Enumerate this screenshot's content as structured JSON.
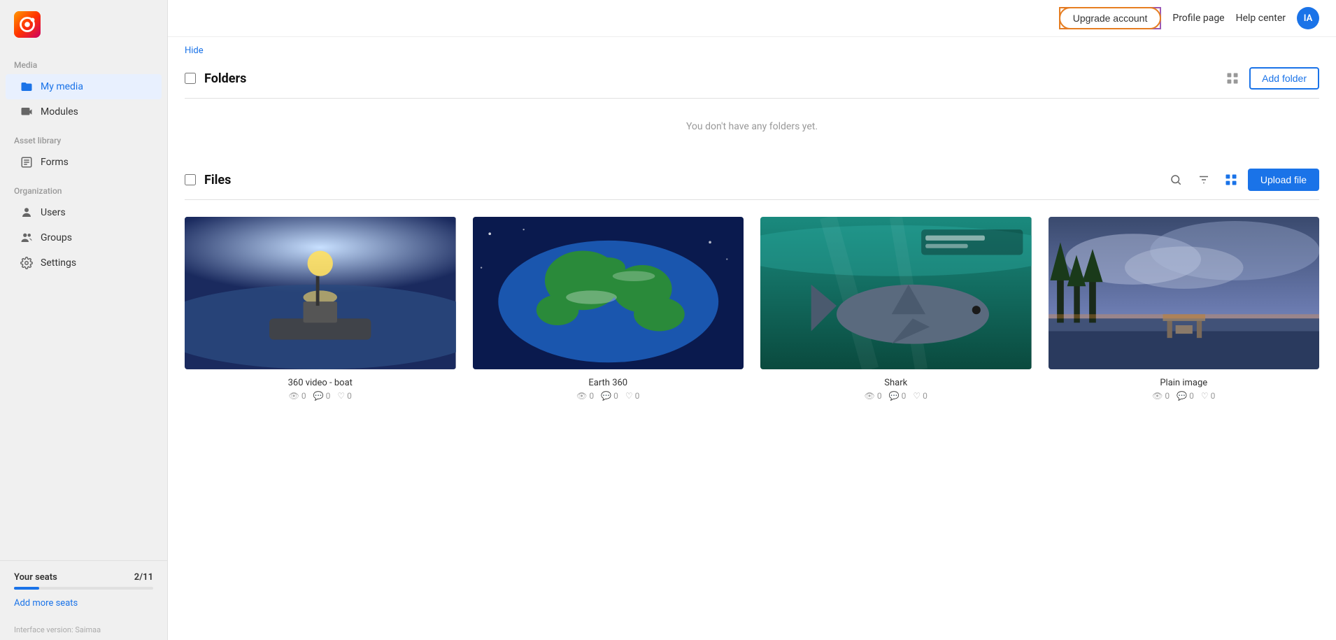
{
  "logo": {
    "alt": "App logo"
  },
  "sidebar": {
    "sections": [
      {
        "label": "Media",
        "items": [
          {
            "id": "my-media",
            "label": "My media",
            "icon": "folder",
            "active": true
          },
          {
            "id": "modules",
            "label": "Modules",
            "icon": "video",
            "active": false
          }
        ]
      },
      {
        "label": "Asset library",
        "items": [
          {
            "id": "forms",
            "label": "Forms",
            "icon": "form",
            "active": false
          }
        ]
      },
      {
        "label": "Organization",
        "items": [
          {
            "id": "users",
            "label": "Users",
            "icon": "user",
            "active": false
          },
          {
            "id": "groups",
            "label": "Groups",
            "icon": "group",
            "active": false
          },
          {
            "id": "settings",
            "label": "Settings",
            "icon": "settings",
            "active": false
          }
        ]
      }
    ],
    "seats": {
      "label": "Your seats",
      "value": "2/11",
      "progress_pct": 18,
      "add_link": "Add more seats"
    },
    "interface_version": "Interface version: Saimaa"
  },
  "topnav": {
    "upgrade_btn": "Upgrade account",
    "profile_link": "Profile page",
    "help_link": "Help center",
    "user_initials": "IA"
  },
  "content": {
    "hide_link": "Hide",
    "folders": {
      "title": "Folders",
      "empty_message": "You don't have any folders yet.",
      "add_button": "Add folder"
    },
    "files": {
      "title": "Files",
      "upload_button": "Upload file",
      "items": [
        {
          "id": "boat",
          "name": "360 video - boat",
          "views": "0",
          "comments": "0",
          "likes": "0",
          "thumb_type": "boat"
        },
        {
          "id": "earth",
          "name": "Earth 360",
          "views": "0",
          "comments": "0",
          "likes": "0",
          "thumb_type": "earth"
        },
        {
          "id": "shark",
          "name": "Shark",
          "views": "0",
          "comments": "0",
          "likes": "0",
          "thumb_type": "shark"
        },
        {
          "id": "plain",
          "name": "Plain image",
          "views": "0",
          "comments": "0",
          "likes": "0",
          "thumb_type": "plain"
        }
      ]
    }
  }
}
